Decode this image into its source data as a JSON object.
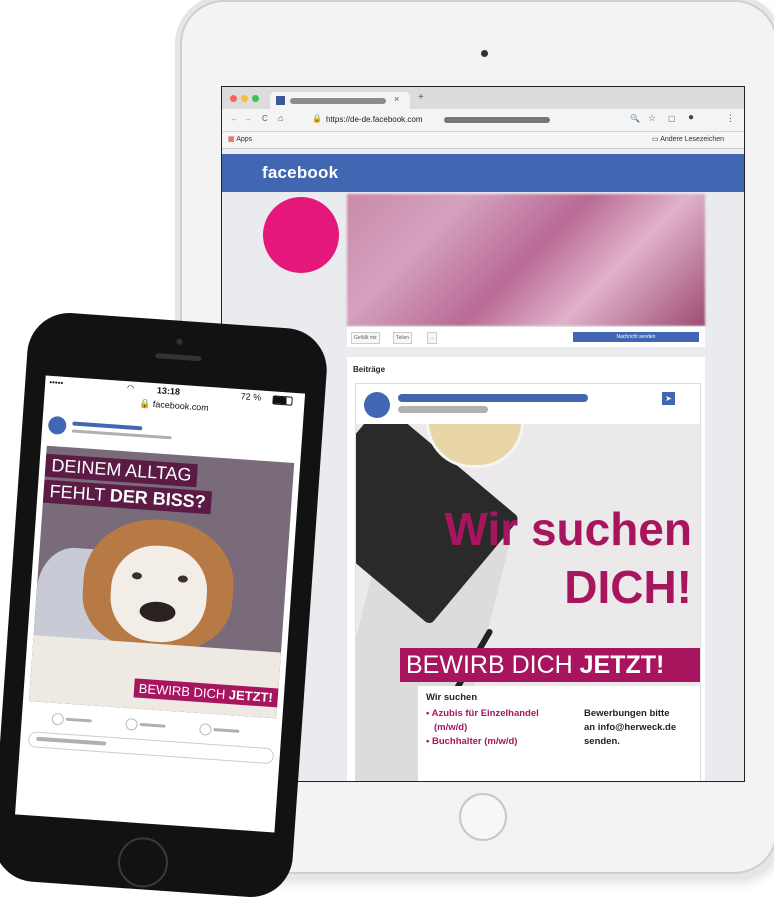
{
  "browser": {
    "tab_label": "",
    "tab_close": "×",
    "tab_new": "+",
    "url": "https://de-de.facebook.com",
    "bookmarks_left": "Apps",
    "bookmarks_right": "Andere Lesezeichen",
    "nav_back": "←",
    "nav_forward": "→",
    "nav_reload": "C",
    "nav_home": "⌂"
  },
  "facebook": {
    "logo": "facebook",
    "cover_buttons": [
      "Gefällt mir",
      "Teilen",
      "..."
    ],
    "message_button": "Nachricht senden",
    "posts_heading": "Beiträge"
  },
  "ad_tablet": {
    "headline_line1": "Wir suchen",
    "headline_line2": "DICH!",
    "banner_normal": "BEWIRB DICH ",
    "banner_bold": "JETZT!",
    "info_heading": "Wir suchen",
    "items": [
      "• Azubis für Einzelhandel",
      "(m/w/d)",
      "• Buchhalter (m/w/d)"
    ],
    "contact": [
      "Bewerbungen bitte",
      "an info@herweck.de",
      "senden."
    ]
  },
  "phone": {
    "carrier": "•••••",
    "time": "13:18",
    "battery": "72 %",
    "url": "facebook.com",
    "ad_line1": "DEINEM ALLTAG",
    "ad_line2_normal": "FEHLT ",
    "ad_line2_bold": "DER BISS?",
    "ad_banner_normal": "BEWIRB DICH ",
    "ad_banner_bold": "JETZT!"
  },
  "colors": {
    "facebook_blue": "#4267b2",
    "brand_magenta": "#a8155f",
    "profile_pink": "#e5177b"
  }
}
